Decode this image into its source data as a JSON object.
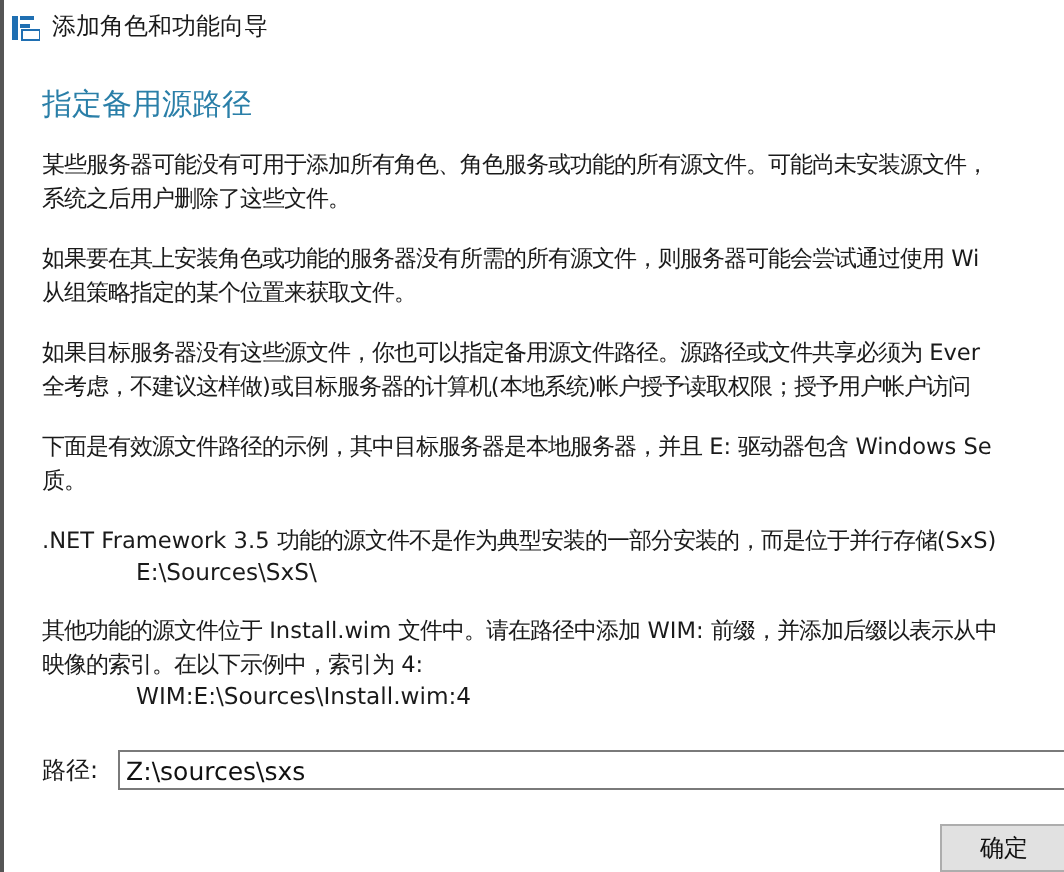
{
  "window": {
    "title": "添加角色和功能向导"
  },
  "heading": "指定备用源路径",
  "paragraphs": [
    {
      "lines": [
        "某些服务器可能没有可用于添加所有角色、角色服务或功能的所有源文件。可能尚未安装源文件，",
        "系统之后用户删除了这些文件。"
      ]
    },
    {
      "lines": [
        "如果要在其上安装角色或功能的服务器没有所需的所有源文件，则服务器可能会尝试通过使用 Wi",
        "从组策略指定的某个位置来获取文件。"
      ]
    },
    {
      "lines": [
        "如果目标服务器没有这些源文件，你也可以指定备用源文件路径。源路径或文件共享必须为 Ever",
        "全考虑，不建议这样做)或目标服务器的计算机(本地系统)帐户授予读取权限；授予用户帐户访问"
      ]
    },
    {
      "lines": [
        "下面是有效源文件路径的示例，其中目标服务器是本地服务器，并且 E: 驱动器包含 Windows Se",
        "质。"
      ]
    },
    {
      "lines": [
        ".NET Framework 3.5 功能的源文件不是作为典型安装的一部分安装的，而是位于并行存储(SxS)"
      ],
      "example": "E:\\Sources\\SxS\\"
    },
    {
      "lines": [
        "其他功能的源文件位于 Install.wim 文件中。请在路径中添加 WIM: 前缀，并添加后缀以表示从中",
        "映像的索引。在以下示例中，索引为 4:"
      ],
      "example": "WIM:E:\\Sources\\Install.wim:4"
    }
  ],
  "path_field": {
    "label": "路径:",
    "value": "Z:\\sources\\sxs"
  },
  "buttons": [
    "确定"
  ]
}
